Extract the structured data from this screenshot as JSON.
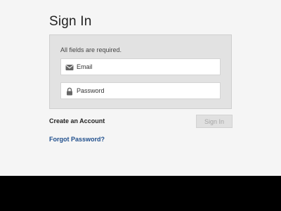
{
  "heading": "Sign In",
  "form": {
    "note": "All fields are required.",
    "email": {
      "placeholder": "Email",
      "icon": "envelope-icon"
    },
    "password": {
      "placeholder": "Password",
      "icon": "lock-icon"
    }
  },
  "links": {
    "create_account": "Create an Account",
    "forgot_password": "Forgot Password?"
  },
  "buttons": {
    "sign_in": "Sign In"
  },
  "colors": {
    "page_bg": "#f5f5f5",
    "panel_bg": "#e2e2e2",
    "link": "#1f4e8c",
    "disabled_button_text": "#a6a6a6",
    "footer_bg": "#000000"
  }
}
